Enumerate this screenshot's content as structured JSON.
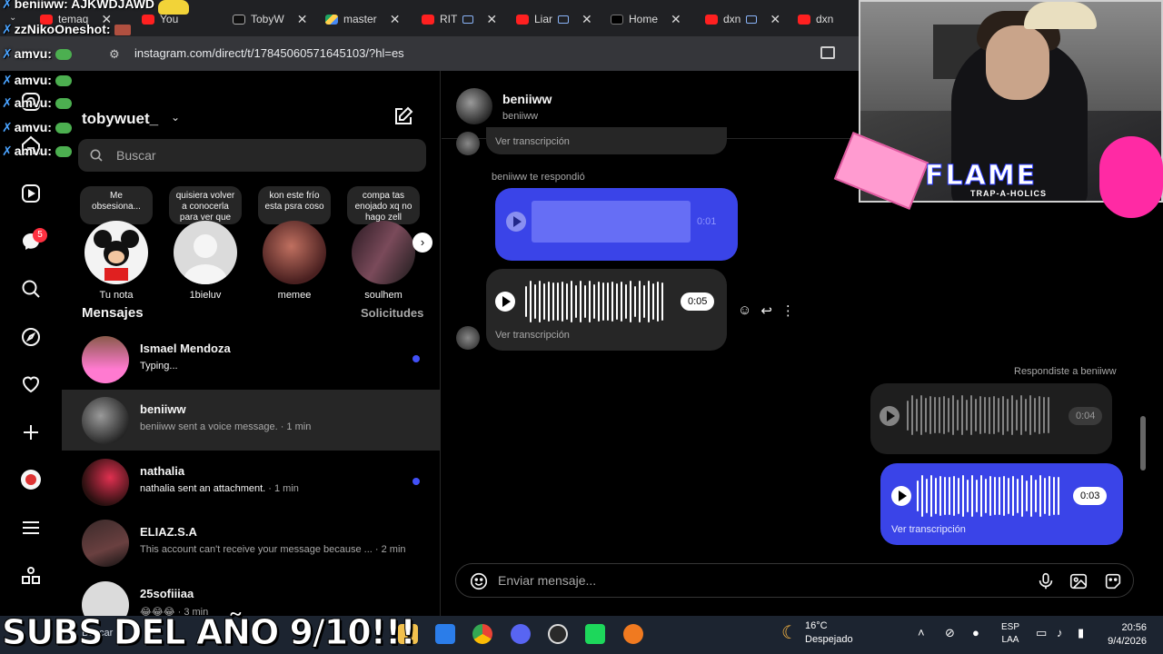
{
  "browser": {
    "tabs": [
      {
        "label": "temaq"
      },
      {
        "label": "You"
      },
      {
        "label": "TobyW"
      },
      {
        "label": "master"
      },
      {
        "label": "RIT"
      },
      {
        "label": "Liar"
      },
      {
        "label": "Home"
      },
      {
        "label": "dxn"
      },
      {
        "label": "dxn"
      }
    ],
    "url": "instagram.com/direct/t/17845060571645103/?hl=es"
  },
  "stream_chat": [
    {
      "nick": "beniiww:",
      "msg": "AJKWDJAWD"
    },
    {
      "nick": "zzNikoOneshot:",
      "msg": ""
    },
    {
      "nick": "amvu:",
      "msg": ""
    },
    {
      "nick": "amvu:",
      "msg": ""
    },
    {
      "nick": "amvu:",
      "msg": ""
    },
    {
      "nick": "amvu:",
      "msg": ""
    },
    {
      "nick": "amvu:",
      "msg": ""
    }
  ],
  "rail": {
    "notifications_badge": "5"
  },
  "inbox": {
    "username": "tobywuet_",
    "search_placeholder": "Buscar",
    "notes": [
      {
        "text": "Me obsesiona...",
        "name": "Tu nota"
      },
      {
        "text": "quisiera volver a conocerla para ver que errore...",
        "name": "1bieluv"
      },
      {
        "text": "kon este frío esta psra coso",
        "name": "memee"
      },
      {
        "text": "compa tas enojado xq no hago zell type...",
        "name": "soulhem"
      }
    ],
    "section_title": "Mensajes",
    "requests_label": "Solicitudes",
    "conversations": [
      {
        "name": "Ismael Mendoza",
        "preview": "Typing...",
        "time": ""
      },
      {
        "name": "beniiww",
        "preview": "beniiww sent a voice message.",
        "time": "· 1 min"
      },
      {
        "name": "nathalia",
        "preview": "nathalia sent an attachment.",
        "time": "· 1 min"
      },
      {
        "name": "ELIAZ.S.A",
        "preview": "This account can't receive your message because ...",
        "time": "· 2 min"
      },
      {
        "name": "25sofiiiaa",
        "preview": "😂😂😂",
        "time": "· 3 min"
      }
    ]
  },
  "thread": {
    "name": "beniiww",
    "username": "beniiww",
    "top_transcript": "Ver transcripción",
    "replied_label": "beniiww te respondió",
    "quoted_voice_time": "0:01",
    "voice_time": "0:05",
    "voice_transcript": "Ver transcripción",
    "you_replied_label": "Respondiste a beniiww",
    "quoted_reply_time": "0:04",
    "my_voice_time": "0:03",
    "my_transcript": "Ver transcripción",
    "composer_placeholder": "Enviar mensaje..."
  },
  "overlay": {
    "brand": "FLAME",
    "brand_sub": "TRAP-A-HOLICS",
    "banner": "SUBS DEL AÑO 9/10!!!"
  },
  "taskbar": {
    "search": "Buscar",
    "temperature": "16°C",
    "weather": "Despejado",
    "lang_1": "ESP",
    "lang_2": "LAA",
    "time": "20:56",
    "date": "9/4/2026"
  },
  "colors": {
    "accent_blue": "#4150f7",
    "bubble_purple": "#3a44e8",
    "panel_grey": "#262626"
  }
}
